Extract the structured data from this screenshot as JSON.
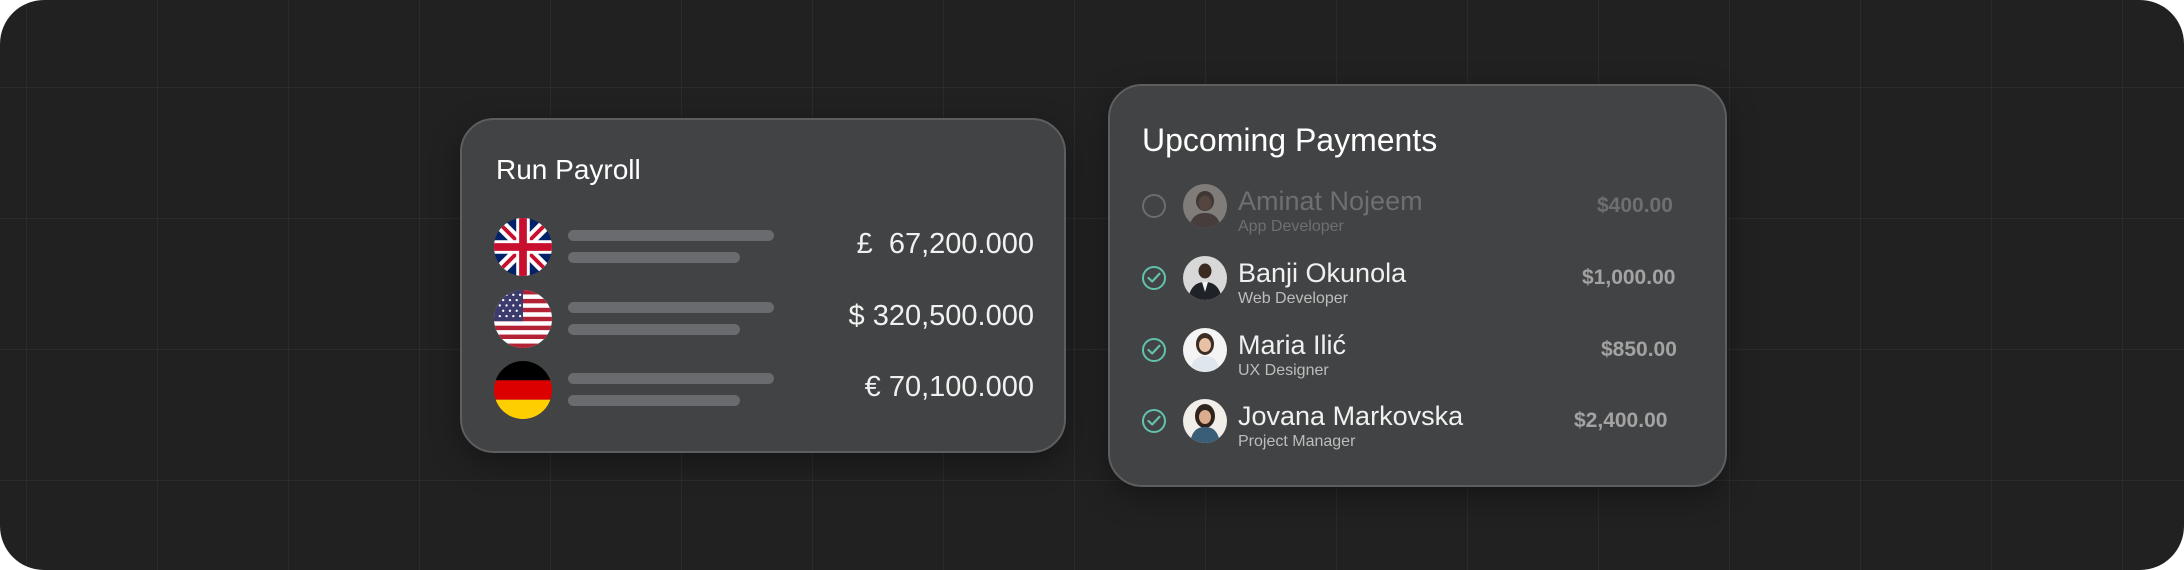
{
  "payroll": {
    "title": "Run Payroll",
    "rows": [
      {
        "flag": "uk-flag-icon",
        "amount": "£  67,200.000"
      },
      {
        "flag": "us-flag-icon",
        "amount": "$ 320,500.000"
      },
      {
        "flag": "germany-flag-icon",
        "amount": "€ 70,100.000"
      }
    ]
  },
  "payments": {
    "title": "Upcoming Payments",
    "items": [
      {
        "name": "Aminat Nojeem",
        "role": "App Developer",
        "amount": "$400.00",
        "checked": false
      },
      {
        "name": "Banji Okunola",
        "role": "Web Developer",
        "amount": "$1,000.00",
        "checked": true
      },
      {
        "name": "Maria Ilić",
        "role": "UX Designer",
        "amount": "$850.00",
        "checked": true
      },
      {
        "name": "Jovana Markovska",
        "role": "Project Manager",
        "amount": "$2,400.00",
        "checked": true
      }
    ]
  },
  "colors": {
    "background": "#212121",
    "card": "#424344",
    "check_accent": "#63c2ae"
  }
}
